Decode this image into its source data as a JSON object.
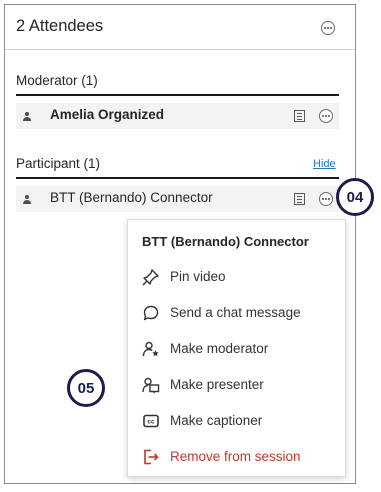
{
  "panel": {
    "title": "2 Attendees",
    "more_icon": "more-options-icon"
  },
  "moderator": {
    "heading": "Moderator (1)",
    "rows": [
      {
        "name": "Amelia Organized"
      }
    ]
  },
  "participant": {
    "heading": "Participant (1)",
    "hide_label": "Hide",
    "rows": [
      {
        "name": "BTT (Bernando) Connector"
      }
    ]
  },
  "menu": {
    "title": "BTT (Bernando) Connector",
    "items": [
      {
        "label": "Pin video",
        "icon": "pin-icon"
      },
      {
        "label": "Send a chat message",
        "icon": "chat-bubble-icon"
      },
      {
        "label": "Make moderator",
        "icon": "moderator-icon"
      },
      {
        "label": "Make presenter",
        "icon": "presenter-icon"
      },
      {
        "label": "Make captioner",
        "icon": "captions-icon"
      },
      {
        "label": "Remove from session",
        "icon": "exit-icon",
        "color": "#c0392b"
      }
    ]
  },
  "callouts": {
    "first": "04",
    "second": "05"
  },
  "colors": {
    "callout": "#1a1d4a",
    "link": "#1f7ac0",
    "danger": "#c0392b"
  }
}
